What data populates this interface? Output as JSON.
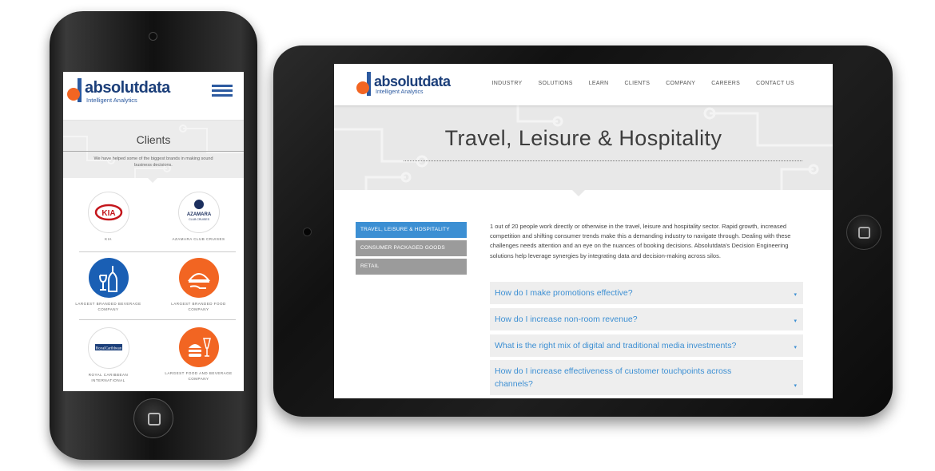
{
  "brand": {
    "name": "absolutdata",
    "tagline": "Intelligent Analytics",
    "colors": {
      "primary": "#1c3f7a",
      "accent_orange": "#f26522",
      "link_blue": "#3c8fd3",
      "inactive_gray": "#9b9b9b"
    }
  },
  "phone": {
    "menu_icon": "hamburger-icon",
    "page_title": "Clients",
    "subtitle": "We have helped some of the biggest brands in making sound business decisions.",
    "clients": [
      {
        "caption": "KIA",
        "logo_text": "KIA",
        "icon": "kia-logo"
      },
      {
        "caption": "AZAMARA CLUB CRUISES",
        "logo_text": "AZAMARA",
        "logo_sub": "CLUB CRUISES",
        "icon": "azamara-logo"
      },
      {
        "caption": "LARGEST BRANDED BEVERAGE COMPANY",
        "icon": "wine-bottle-icon"
      },
      {
        "caption": "LARGEST BRANDED FOOD COMPANY",
        "icon": "serving-hand-icon"
      },
      {
        "caption": "ROYAL CARIBBEAN INTERNATIONAL",
        "logo_text": "RoyalCaribbean",
        "icon": "royal-caribbean-logo"
      },
      {
        "caption": "LARGEST FOOD AND BEVERAGE COMPANY",
        "icon": "burger-drink-icon"
      }
    ]
  },
  "tablet": {
    "nav": [
      "INDUSTRY",
      "SOLUTIONS",
      "LEARN",
      "CLIENTS",
      "COMPANY",
      "CAREERS",
      "CONTACT US"
    ],
    "hero_title": "Travel, Leisure & Hospitality",
    "sidebar": [
      {
        "label": "TRAVEL, LEISURE & HOSPITALITY",
        "active": true
      },
      {
        "label": "CONSUMER PACKAGED GOODS",
        "active": false
      },
      {
        "label": "RETAIL",
        "active": false
      }
    ],
    "intro": "1 out of 20 people work directly or otherwise in the travel, leisure and hospitality sector. Rapid growth, increased competition and shifting consumer trends make this a demanding industry to navigate through. Dealing with these challenges needs attention and an eye on the nuances of booking decisions. Absolutdata's Decision Engineering solutions help leverage synergies by integrating data and decision-making across silos.",
    "questions": [
      "How do I make promotions effective?",
      "How do I increase non-room revenue?",
      "What is the right mix of digital and traditional media investments?",
      "How do I increase effectiveness of customer touchpoints across channels?"
    ],
    "caret_glyph": "▾"
  }
}
